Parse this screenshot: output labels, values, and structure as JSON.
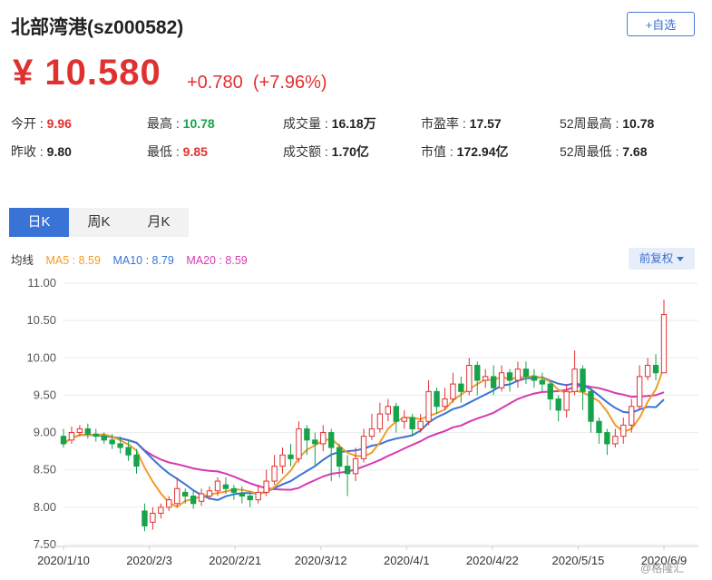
{
  "stock": {
    "title": "北部湾港(sz000582)",
    "add_fav": "+自选",
    "price": "¥ 10.580",
    "change": "+0.780",
    "change_pct": "(+7.96%)"
  },
  "stats": [
    {
      "label": "今开 : ",
      "value": "9.96",
      "tone": "up"
    },
    {
      "label": "最高 : ",
      "value": "10.78",
      "tone": "dn"
    },
    {
      "label": "成交量 : ",
      "value": "16.18万",
      "tone": "blk"
    },
    {
      "label": "市盈率 : ",
      "value": "17.57",
      "tone": "blk"
    },
    {
      "label": "52周最高 : ",
      "value": "10.78",
      "tone": "blk"
    },
    {
      "label": "昨收 : ",
      "value": "9.80",
      "tone": "blk"
    },
    {
      "label": "最低 : ",
      "value": "9.85",
      "tone": "up"
    },
    {
      "label": "成交额 : ",
      "value": "1.70亿",
      "tone": "blk"
    },
    {
      "label": "市值 : ",
      "value": "172.94亿",
      "tone": "blk"
    },
    {
      "label": "52周最低 : ",
      "value": "7.68",
      "tone": "blk"
    }
  ],
  "tabs": [
    "日K",
    "周K",
    "月K"
  ],
  "legend": {
    "label": "均线",
    "ma5": "MA5 : 8.59",
    "ma10": "MA10 : 8.79",
    "ma20": "MA20 : 8.59"
  },
  "adjust": "前复权",
  "watermark": "@格隆汇",
  "colors": {
    "up": "#e03131",
    "down": "#17a34a",
    "ma5": "#f39c28",
    "ma10": "#3a73d6",
    "ma20": "#d63ab3",
    "accent": "#3a73d6"
  },
  "chart_data": {
    "type": "candlestick",
    "y_ticks": [
      "11.00",
      "10.50",
      "10.00",
      "9.50",
      "9.00",
      "8.50",
      "8.00",
      "7.50"
    ],
    "ylim": [
      7.5,
      11.0
    ],
    "x_ticks": [
      "2020/1/10",
      "2020/2/3",
      "2020/2/21",
      "2020/3/12",
      "2020/4/1",
      "2020/4/22",
      "2020/5/15",
      "2020/6/9"
    ],
    "candles": [
      [
        8.95,
        8.85,
        9.05,
        8.8
      ],
      [
        8.9,
        9.0,
        9.08,
        8.85
      ],
      [
        9.0,
        9.05,
        9.1,
        8.95
      ],
      [
        9.05,
        8.98,
        9.12,
        8.92
      ],
      [
        8.98,
        8.95,
        9.05,
        8.88
      ],
      [
        8.95,
        8.9,
        9.0,
        8.85
      ],
      [
        8.9,
        8.85,
        8.98,
        8.78
      ],
      [
        8.85,
        8.8,
        8.95,
        8.72
      ],
      [
        8.8,
        8.7,
        8.9,
        8.62
      ],
      [
        8.7,
        8.55,
        8.78,
        8.45
      ],
      [
        7.95,
        7.75,
        8.05,
        7.68
      ],
      [
        7.8,
        7.92,
        8.0,
        7.7
      ],
      [
        7.92,
        8.0,
        8.05,
        7.85
      ],
      [
        8.0,
        8.1,
        8.15,
        7.95
      ],
      [
        8.05,
        8.25,
        8.4,
        8.0
      ],
      [
        8.2,
        8.15,
        8.25,
        8.05
      ],
      [
        8.15,
        8.05,
        8.22,
        7.98
      ],
      [
        8.08,
        8.18,
        8.25,
        8.02
      ],
      [
        8.15,
        8.22,
        8.28,
        8.1
      ],
      [
        8.22,
        8.35,
        8.4,
        8.15
      ],
      [
        8.3,
        8.25,
        8.4,
        8.18
      ],
      [
        8.25,
        8.2,
        8.3,
        8.1
      ],
      [
        8.18,
        8.15,
        8.28,
        8.05
      ],
      [
        8.15,
        8.1,
        8.22,
        8.0
      ],
      [
        8.1,
        8.2,
        8.3,
        8.05
      ],
      [
        8.2,
        8.35,
        8.5,
        8.15
      ],
      [
        8.35,
        8.55,
        8.7,
        8.3
      ],
      [
        8.55,
        8.7,
        8.8,
        8.45
      ],
      [
        8.7,
        8.65,
        8.85,
        8.55
      ],
      [
        8.65,
        9.05,
        9.15,
        8.6
      ],
      [
        9.05,
        8.9,
        9.1,
        8.7
      ],
      [
        8.9,
        8.85,
        9.0,
        8.55
      ],
      [
        8.85,
        9.0,
        9.1,
        8.75
      ],
      [
        9.0,
        8.8,
        9.05,
        8.35
      ],
      [
        8.8,
        8.55,
        8.85,
        8.4
      ],
      [
        8.55,
        8.45,
        8.7,
        8.15
      ],
      [
        8.45,
        8.65,
        8.8,
        8.35
      ],
      [
        8.65,
        8.95,
        9.05,
        8.6
      ],
      [
        8.95,
        9.05,
        9.25,
        8.9
      ],
      [
        9.05,
        9.25,
        9.4,
        9.0
      ],
      [
        9.25,
        9.35,
        9.45,
        9.15
      ],
      [
        9.35,
        9.15,
        9.4,
        9.0
      ],
      [
        9.15,
        9.2,
        9.3,
        9.05
      ],
      [
        9.2,
        9.05,
        9.25,
        8.95
      ],
      [
        9.05,
        9.15,
        9.25,
        9.0
      ],
      [
        9.15,
        9.55,
        9.7,
        9.1
      ],
      [
        9.55,
        9.35,
        9.6,
        9.25
      ],
      [
        9.35,
        9.45,
        9.6,
        9.3
      ],
      [
        9.45,
        9.65,
        9.8,
        9.4
      ],
      [
        9.65,
        9.55,
        9.75,
        9.4
      ],
      [
        9.55,
        9.9,
        10.0,
        9.5
      ],
      [
        9.9,
        9.7,
        9.95,
        9.5
      ],
      [
        9.7,
        9.75,
        9.85,
        9.6
      ],
      [
        9.75,
        9.6,
        9.9,
        9.5
      ],
      [
        9.6,
        9.8,
        9.9,
        9.55
      ],
      [
        9.8,
        9.7,
        9.85,
        9.55
      ],
      [
        9.7,
        9.85,
        9.95,
        9.6
      ],
      [
        9.85,
        9.75,
        9.95,
        9.65
      ],
      [
        9.75,
        9.7,
        9.85,
        9.6
      ],
      [
        9.7,
        9.65,
        9.8,
        9.55
      ],
      [
        9.65,
        9.45,
        9.7,
        9.3
      ],
      [
        9.45,
        9.3,
        9.5,
        9.15
      ],
      [
        9.3,
        9.55,
        9.65,
        9.2
      ],
      [
        9.55,
        9.85,
        10.1,
        9.5
      ],
      [
        9.85,
        9.55,
        9.9,
        9.3
      ],
      [
        9.55,
        9.15,
        9.6,
        9.0
      ],
      [
        9.15,
        9.0,
        9.2,
        8.85
      ],
      [
        9.0,
        8.85,
        9.05,
        8.7
      ],
      [
        8.85,
        8.95,
        9.05,
        8.8
      ],
      [
        8.95,
        9.1,
        9.2,
        8.85
      ],
      [
        9.1,
        9.35,
        9.45,
        9.0
      ],
      [
        9.35,
        9.75,
        9.9,
        9.3
      ],
      [
        9.75,
        9.9,
        10.0,
        9.7
      ],
      [
        9.9,
        9.8,
        10.05,
        9.7
      ],
      [
        9.8,
        10.58,
        10.78,
        9.85
      ]
    ]
  }
}
